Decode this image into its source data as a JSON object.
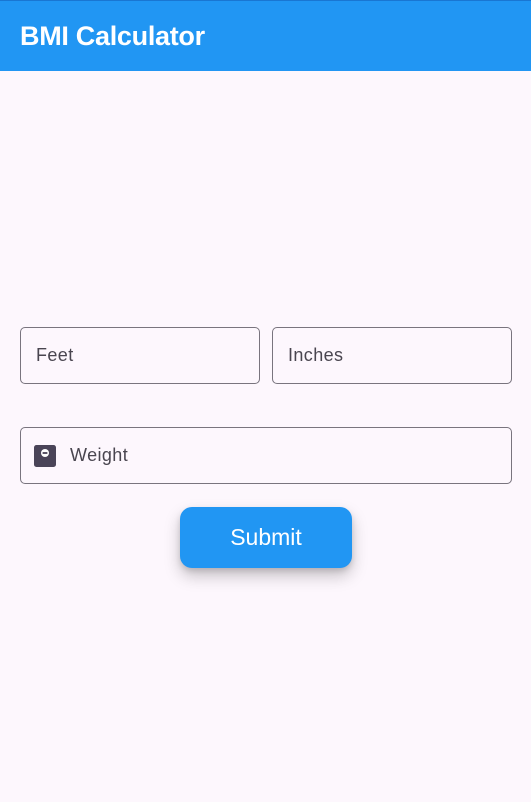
{
  "app_bar": {
    "title": "BMI Calculator",
    "color": "#2196f3"
  },
  "form": {
    "feet_field": {
      "label": "Feet",
      "value": ""
    },
    "inches_field": {
      "label": "Inches",
      "value": ""
    },
    "weight_field": {
      "label": "Weight",
      "value": "",
      "icon": "scale-icon"
    },
    "submit_label": "Submit"
  },
  "colors": {
    "background": "#fdf7fd",
    "accent": "#2196f3",
    "outline": "#79747e"
  }
}
